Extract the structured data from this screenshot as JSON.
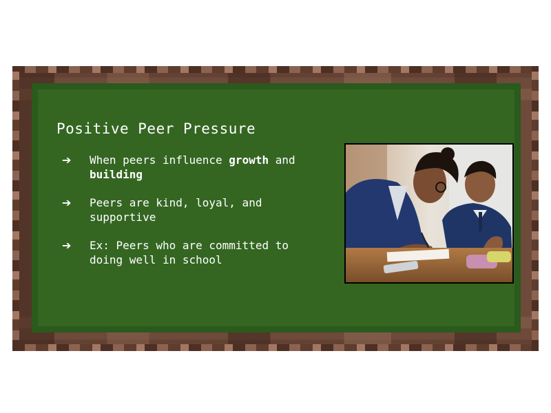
{
  "slide": {
    "title": "Positive Peer Pressure",
    "bullets": [
      {
        "parts": [
          "When peers influence ",
          "growth",
          " and ",
          "building"
        ]
      },
      {
        "text": "Peers are kind, loyal, and supportive"
      },
      {
        "text": "Ex: Peers who are committed to doing well in school"
      }
    ],
    "bullet_icon": "arrow-right-icon",
    "colors": {
      "board_green": "#346622",
      "board_border_green": "#2a5a1c",
      "frame_brown": "#6e4a3a",
      "text": "#ffffff"
    }
  }
}
